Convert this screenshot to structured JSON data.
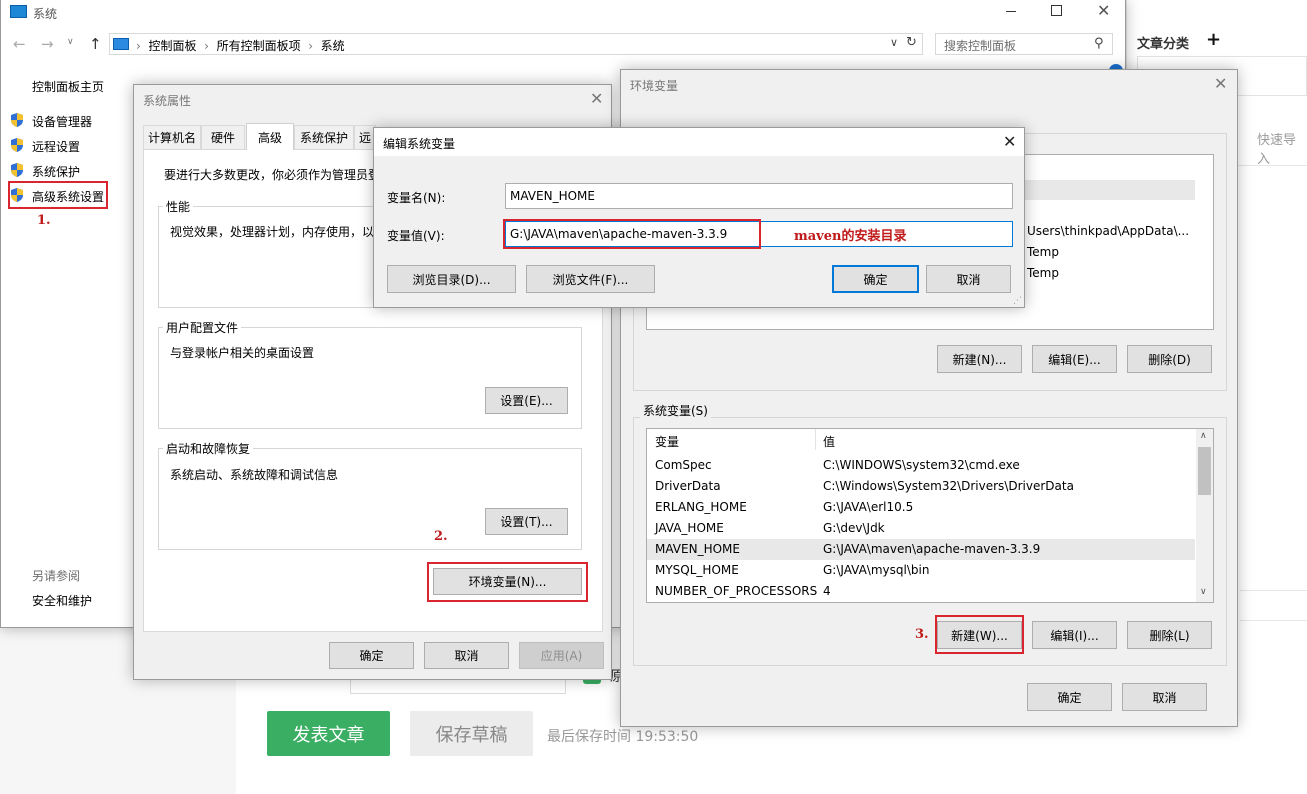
{
  "background_page": {
    "article_category_label": "文章分类",
    "plus_icon": "plus-icon",
    "quick_import": "快速导入",
    "publish_button": "发表文章",
    "save_draft_button": "保存草稿",
    "last_saved": "最后保存时间 19:53:50",
    "checkbox_label_fragment": "原",
    "publish_color": "#3aae62"
  },
  "control_panel": {
    "title": "系统",
    "address_path": [
      "控制面板",
      "所有控制面板项",
      "系统"
    ],
    "search_placeholder": "搜索控制面板",
    "home_link": "控制面板主页",
    "nav_items": [
      "设备管理器",
      "远程设置",
      "系统保护",
      "高级系统设置"
    ],
    "see_also_header": "另请参阅",
    "see_also_link": "安全和维护",
    "step_label": "1."
  },
  "system_properties": {
    "title": "系统属性",
    "tabs": [
      "计算机名",
      "硬件",
      "高级",
      "系统保护",
      "远"
    ],
    "active_tab_index": 2,
    "admin_note": "要进行大多数更改，你必须作为管理员登",
    "performance": {
      "title": "性能",
      "description": "视觉效果，处理器计划，内存使用，以"
    },
    "user_profiles": {
      "title": "用户配置文件",
      "description": "与登录帐户相关的桌面设置",
      "button": "设置(E)..."
    },
    "startup_recovery": {
      "title": "启动和故障恢复",
      "description": "系统启动、系统故障和调试信息",
      "button": "设置(T)..."
    },
    "env_button": "环境变量(N)...",
    "step_label": "2.",
    "ok": "确定",
    "cancel": "取消",
    "apply": "应用(A)"
  },
  "edit_variable": {
    "title": "编辑系统变量",
    "name_label": "变量名(N):",
    "name_value": "MAVEN_HOME",
    "value_label": "变量值(V):",
    "value_value": "G:\\JAVA\\maven\\apache-maven-3.3.9",
    "annotation": "maven的安装目录",
    "browse_dir": "浏览目录(D)...",
    "browse_file": "浏览文件(F)...",
    "ok": "确定",
    "cancel": "取消"
  },
  "env_variables": {
    "title": "环境变量",
    "user_vars_visible": [
      "Users\\thinkpad\\AppData\\...",
      "Temp",
      "Temp"
    ],
    "user_new": "新建(N)...",
    "user_edit": "编辑(E)...",
    "user_delete": "删除(D)",
    "system_section": "系统变量(S)",
    "columns": [
      "变量",
      "值"
    ],
    "rows": [
      {
        "name": "ComSpec",
        "value": "C:\\WINDOWS\\system32\\cmd.exe"
      },
      {
        "name": "DriverData",
        "value": "C:\\Windows\\System32\\Drivers\\DriverData"
      },
      {
        "name": "ERLANG_HOME",
        "value": "G:\\JAVA\\erl10.5"
      },
      {
        "name": "JAVA_HOME",
        "value": "G:\\dev\\Jdk"
      },
      {
        "name": "MAVEN_HOME",
        "value": "G:\\JAVA\\maven\\apache-maven-3.3.9"
      },
      {
        "name": "MYSQL_HOME",
        "value": "G:\\JAVA\\mysql\\bin"
      },
      {
        "name": "NUMBER_OF_PROCESSORS",
        "value": "4"
      }
    ],
    "selected_row_index": 4,
    "sys_new": "新建(W)...",
    "sys_edit": "编辑(I)...",
    "sys_delete": "删除(L)",
    "step_label": "3.",
    "ok": "确定",
    "cancel": "取消"
  },
  "colors": {
    "annotation_red": "#d9262e",
    "accent_blue": "#0078d7",
    "selection_gray": "#e8e8e8"
  }
}
